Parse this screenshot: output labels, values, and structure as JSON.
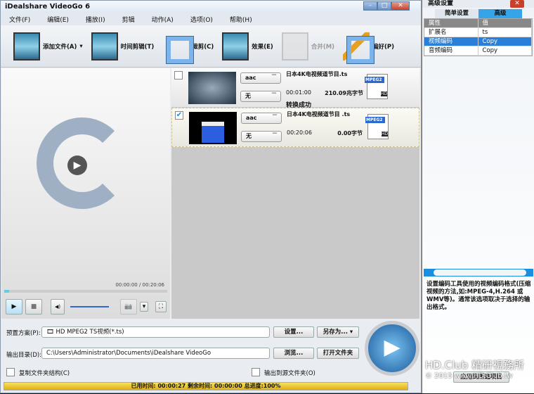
{
  "window": {
    "title": "iDealshare VideoGo 6",
    "min": "–",
    "max": "□",
    "close": "✕"
  },
  "menu": [
    "文件(F)",
    "编辑(E)",
    "播放(I)",
    "剪辑",
    "动作(A)",
    "选项(O)",
    "帮助(H)"
  ],
  "toolbar": {
    "add_file": "添加文件(A)",
    "trim": "时间剪辑(T)",
    "crop": "裁剪(C)",
    "effect": "效果(E)",
    "merge": "合并(M)",
    "prefs": "偏好(P)",
    "dropdown": "▾"
  },
  "player": {
    "time": "00:00:00 / 00:20:06",
    "progress": 0.03,
    "play": "▶",
    "stop": "■",
    "volume": "◀)",
    "snapshot": "📷",
    "snap_menu": "▾",
    "fullscreen": "⛶",
    "logo_play": "▶"
  },
  "files": [
    {
      "checked": false,
      "audio": "aac",
      "subtitle": "无",
      "name": "日本4K电视频道节目.ts",
      "duration": "00:01:00",
      "size": "210.09兆字节",
      "status": "转换成功",
      "format": "MPEG2",
      "badge": "HD"
    },
    {
      "checked": true,
      "audio": "aac",
      "subtitle": "无",
      "name": "日本4K电视频道节目 .ts",
      "duration": "00:20:06",
      "size": "0.00字节",
      "status": "",
      "format": "MPEG2",
      "badge": "HD"
    }
  ],
  "bottom": {
    "preset_label": "预置方案(P):",
    "preset_value": "HD MPEG2 TS视频(*.ts)",
    "settings": "设置...",
    "save_as": "另存为... ▾",
    "output_label": "输出目录(D):",
    "output_value": "C:\\Users\\Administrator\\Documents\\iDealshare VideoGo",
    "browse": "浏览...",
    "open_folder": "打开文件夹",
    "copy_structure": "复制文件夹结构(C)",
    "output_to_source": "输出到源文件夹(O)",
    "progress_text": "已用时间: 00:00:27 剩余时间: 00:00:00 总进度:100%",
    "progress": 100,
    "convert": "▶"
  },
  "panel": {
    "title": "高级设置",
    "close": "✕",
    "tabs": [
      "简单设置",
      "高级"
    ],
    "headers": [
      "属性",
      "值"
    ],
    "rows": [
      [
        "扩展名",
        "ts"
      ],
      [
        "视频编码",
        "Copy"
      ],
      [
        "音频编码",
        "Copy"
      ]
    ],
    "description": "设置编码工具使用的视频编码格式(压缩视频的方法,如:MPEG-4,H.264 或 WMV等)。通常该选项取决于选择的输出格式。",
    "apply": "应用到所选项目"
  },
  "watermark": {
    "line1": "HD.Club 精研視務所",
    "line2": "© 2015  www.HD.Club.tw"
  },
  "colors": {
    "accent": "#35a4e8",
    "selected_row": "#2a80d8",
    "progress": "#f0c830"
  }
}
